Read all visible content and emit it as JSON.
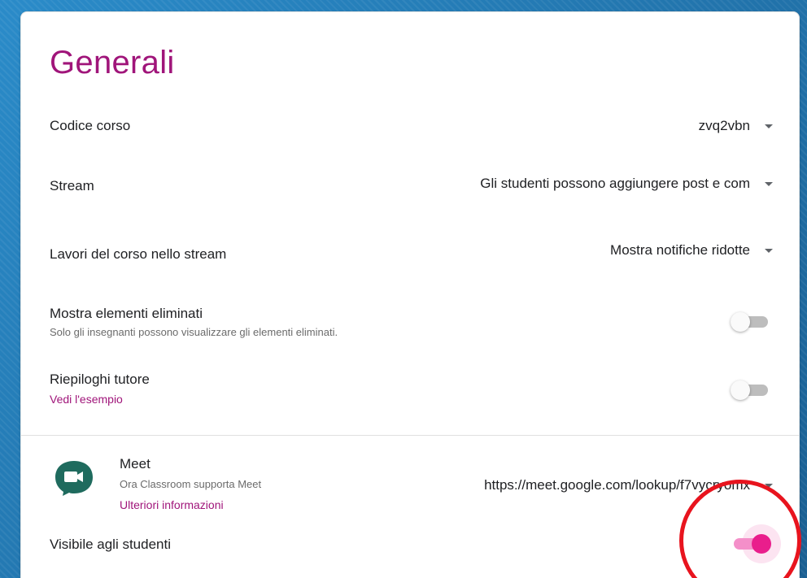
{
  "section": {
    "title": "Generali"
  },
  "settings": {
    "course_code": {
      "label": "Codice corso",
      "value": "zvq2vbn"
    },
    "stream": {
      "label": "Stream",
      "value": "Gli studenti possono aggiungere post e com"
    },
    "classwork": {
      "label": "Lavori del corso nello stream",
      "value": "Mostra notifiche ridotte"
    },
    "show_deleted": {
      "label": "Mostra elementi eliminati",
      "description": "Solo gli insegnanti possono visualizzare gli elementi eliminati.",
      "enabled": false
    },
    "guardian_summaries": {
      "label": "Riepiloghi tutore",
      "link": "Vedi l'esempio",
      "enabled": false
    }
  },
  "meet": {
    "title": "Meet",
    "description": "Ora Classroom supporta Meet",
    "link": "Ulteriori informazioni",
    "url": "https://meet.google.com/lookup/f7vycryomx",
    "visible_label": "Visibile agli studenti",
    "visible_enabled": true
  },
  "colors": {
    "accent": "#a0157a",
    "toggle_on": "#e91e8c",
    "annotation": "#e8141e"
  }
}
